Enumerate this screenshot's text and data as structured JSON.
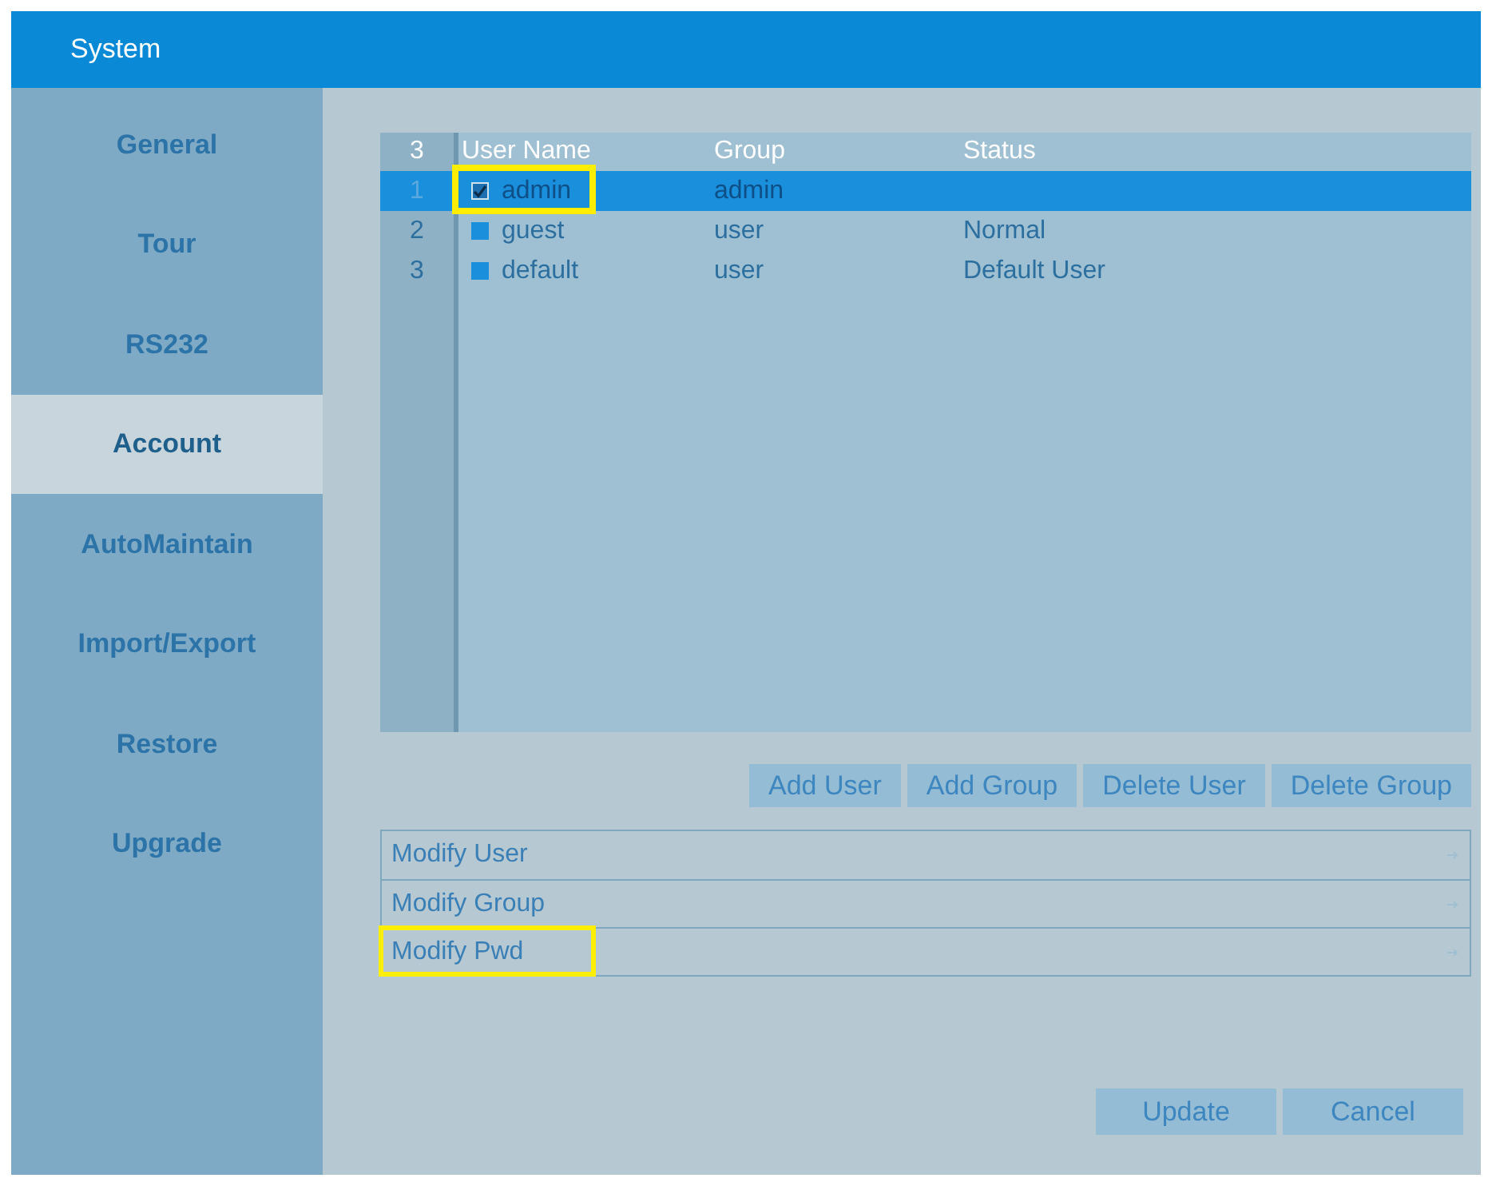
{
  "window": {
    "title": "System"
  },
  "sidebar": {
    "items": [
      {
        "label": "General",
        "selected": false
      },
      {
        "label": "Tour",
        "selected": false
      },
      {
        "label": "RS232",
        "selected": false
      },
      {
        "label": "Account",
        "selected": true
      },
      {
        "label": "AutoMaintain",
        "selected": false
      },
      {
        "label": "Import/Export",
        "selected": false
      },
      {
        "label": "Restore",
        "selected": false
      },
      {
        "label": "Upgrade",
        "selected": false
      }
    ]
  },
  "table": {
    "count": "3",
    "columns": [
      "User Name",
      "Group",
      "Status"
    ],
    "rows": [
      {
        "index": "1",
        "checked": true,
        "selected": true,
        "highlighted": true,
        "cells": [
          "admin",
          "admin"
        ]
      },
      {
        "index": "2",
        "checked": false,
        "selected": false,
        "highlighted": false,
        "cells": [
          "guest",
          "user",
          "Normal"
        ]
      },
      {
        "index": "3",
        "checked": false,
        "selected": false,
        "highlighted": false,
        "cells": [
          "default",
          "user",
          "Default User"
        ]
      }
    ]
  },
  "actions": [
    "Add User",
    "Add Group",
    "Delete User",
    "Delete Group"
  ],
  "sections": [
    {
      "label": "Modify User",
      "highlighted": false
    },
    {
      "label": "Modify Group",
      "highlighted": false
    },
    {
      "label": "Modify Pwd",
      "highlighted": true
    }
  ],
  "buttons": [
    "Update",
    "Cancel"
  ]
}
